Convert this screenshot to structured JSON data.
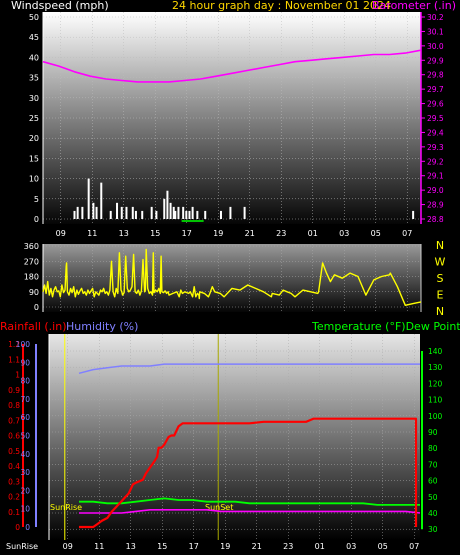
{
  "header": {
    "windspeed": "Windspeed (mph)",
    "day": "24 hour graph day : November 01 2024",
    "barometer": "Barometer (.in)"
  },
  "colors": {
    "windspeed": "#ffffff",
    "barometer": "#ff00ff",
    "day": "#ffd700",
    "wind_dir": "#ffff00",
    "rainfall": "#ff0000",
    "humidity": "#8080ff",
    "temperature": "#00ff00",
    "dew_point": "#ff00ff",
    "sun": "#ffff00"
  },
  "chart_data": [
    {
      "type": "line",
      "title": "24 hour graph day : November 01 2024",
      "x_tick_labels": [
        "09",
        "11",
        "13",
        "15",
        "17",
        "19",
        "21",
        "23",
        "01",
        "03",
        "05",
        "07"
      ],
      "y_left": {
        "label": "Windspeed (mph)",
        "ticks": [
          0,
          5,
          10,
          15,
          20,
          25,
          30,
          35,
          40,
          45,
          50
        ],
        "ylim": [
          0,
          50
        ]
      },
      "y_right": {
        "label": "Barometer (.in)",
        "ticks": [
          28.8,
          28.9,
          29.0,
          29.1,
          29.2,
          29.3,
          29.4,
          29.5,
          29.6,
          29.7,
          29.8,
          29.9,
          30.0,
          30.1,
          30.2
        ],
        "ylim": [
          28.8,
          30.2
        ]
      },
      "series": [
        {
          "name": "Barometer (.in)",
          "axis": "right",
          "kind": "line",
          "x": [
            0,
            1,
            2,
            3,
            4,
            5,
            6,
            7,
            8,
            9,
            10,
            11,
            12,
            13,
            14,
            15,
            16,
            17,
            18,
            19,
            20,
            21,
            22,
            23,
            24
          ],
          "values": [
            29.89,
            29.86,
            29.82,
            29.79,
            29.77,
            29.76,
            29.75,
            29.75,
            29.75,
            29.76,
            29.77,
            29.79,
            29.81,
            29.83,
            29.85,
            29.87,
            29.89,
            29.9,
            29.91,
            29.92,
            29.93,
            29.94,
            29.94,
            29.95,
            29.97
          ]
        },
        {
          "name": "Windspeed (mph)",
          "axis": "left",
          "kind": "bar",
          "x": [
            2.0,
            2.2,
            2.5,
            2.9,
            3.2,
            3.4,
            3.7,
            4.3,
            4.7,
            5.0,
            5.3,
            5.7,
            5.9,
            6.3,
            6.9,
            7.2,
            7.7,
            7.9,
            8.1,
            8.3,
            8.4,
            8.6,
            8.9,
            9.1,
            9.3,
            9.5,
            9.8,
            10.3,
            11.3,
            11.9,
            12.8,
            23.5
          ],
          "values": [
            2,
            3,
            3,
            10,
            4,
            3,
            9,
            2,
            4,
            3,
            3,
            3,
            2,
            2,
            3,
            2,
            5,
            7,
            4,
            3,
            2,
            3,
            3,
            2,
            2,
            3,
            2,
            2,
            2,
            3,
            3,
            2
          ]
        }
      ]
    },
    {
      "type": "line",
      "x_tick_labels": [
        "09",
        "11",
        "13",
        "15",
        "17",
        "19",
        "21",
        "23",
        "01",
        "03",
        "05",
        "07"
      ],
      "y_left": {
        "ticks": [
          0,
          90,
          180,
          270,
          360
        ],
        "ylim": [
          0,
          360
        ]
      },
      "y_right_labels": [
        "N",
        "W",
        "S",
        "E",
        "N"
      ],
      "series": [
        {
          "name": "Wind Direction",
          "kind": "line",
          "x": [
            0.0,
            0.2,
            0.4,
            0.6,
            0.8,
            1.0,
            1.2,
            1.4,
            1.6,
            1.8,
            2.0,
            2.2,
            2.4,
            2.6,
            2.8,
            2.95,
            3.0,
            3.1,
            3.3,
            3.5,
            3.7,
            3.9,
            4.1,
            4.3,
            4.5,
            4.7,
            4.9,
            5.1,
            5.3,
            5.5,
            5.7,
            5.9,
            6.1,
            6.3,
            6.5,
            6.7,
            6.9,
            7.1,
            7.3,
            7.5,
            7.7,
            7.9,
            8.1,
            8.3,
            8.5,
            8.7,
            8.9,
            9.1,
            9.3,
            9.5,
            9.7,
            9.9,
            10.0,
            10.1,
            10.3,
            10.5,
            10.7,
            10.9,
            11.1,
            11.3,
            11.5,
            11.7,
            11.9,
            12.1,
            12.3,
            12.5,
            12.7,
            12.9,
            13.0,
            13.1,
            13.3,
            13.5,
            13.7,
            13.9,
            14.0,
            14.1,
            14.3,
            14.5,
            14.7,
            14.9,
            15.0,
            15.1,
            15.3,
            15.5,
            15.7,
            15.9,
            16.0,
            16.5,
            17.0,
            17.3,
            17.5,
            17.7,
            18.0,
            18.5,
            18.7,
            19.0,
            19.2,
            19.4,
            19.6,
            19.8,
            19.85,
            19.9,
            20.5,
            21.0,
            21.2,
            21.5,
            21.8,
            22.5,
            23.0,
            24.0,
            25.0,
            26.0,
            27.0,
            28.0,
            29.0,
            29.1,
            30.0,
            30.5,
            31.0,
            31.5,
            32.0,
            33.0,
            34.0,
            34.9,
            35.0,
            35.5,
            36.0,
            36.5,
            37.0,
            38.0,
            39.0,
            40.0,
            41.0,
            42.0,
            43.0,
            44.0,
            44.1,
            45.0,
            46.0,
            47.0,
            48.0
          ],
          "values": [
            90,
            130,
            80,
            150,
            70,
            110,
            60,
            100,
            120,
            90,
            95,
            60,
            130,
            85,
            100,
            240,
            260,
            90,
            70,
            110,
            85,
            120,
            60,
            100,
            75,
            95,
            110,
            80,
            90,
            70,
            100,
            80,
            95,
            110,
            60,
            90,
            80,
            70,
            100,
            90,
            110,
            80,
            90,
            70,
            100,
            270,
            90,
            60,
            110,
            80,
            320,
            100,
            90,
            70,
            85,
            300,
            110,
            90,
            100,
            120,
            310,
            90,
            80,
            100,
            70,
            95,
            280,
            90,
            100,
            340,
            110,
            80,
            90,
            70,
            320,
            85,
            100,
            90,
            110,
            80,
            300,
            90,
            85,
            95,
            80,
            90,
            70,
            80,
            90,
            60,
            100,
            80,
            90,
            80,
            90,
            60,
            120,
            60,
            80,
            70,
            50,
            90,
            80,
            60,
            80,
            120,
            90,
            80,
            60,
            110,
            100,
            130,
            110,
            90,
            60,
            80,
            70,
            100,
            90,
            80,
            60,
            100,
            90,
            80,
            90,
            260,
            200,
            150,
            190,
            170,
            200,
            180,
            70,
            160,
            180,
            190,
            200,
            120,
            10,
            20,
            30
          ],
          "note_x_scale": "half-hours"
        }
      ]
    },
    {
      "type": "line",
      "x_tick_labels": [
        "SunRise",
        "09",
        "11",
        "13",
        "15",
        "17",
        "19",
        "21",
        "23",
        "01",
        "03",
        "05",
        "07"
      ],
      "y_left_outer": {
        "label": "Rainfall (.in)",
        "ticks": [
          0,
          0.1,
          0.2,
          0.3,
          0.4,
          0.5,
          0.6,
          0.7,
          0.8,
          0.9,
          1,
          1.1,
          1.2
        ],
        "ylim": [
          0,
          1.2
        ]
      },
      "y_left_inner": {
        "label": "Humidity (%)",
        "ticks": [
          0,
          10,
          20,
          30,
          40,
          50,
          60,
          70,
          80,
          90,
          100
        ],
        "ylim": [
          0,
          100
        ]
      },
      "y_right": {
        "label": "Temperature (°F)Dew Point (°F)",
        "ticks": [
          30,
          40,
          50,
          60,
          70,
          80,
          90,
          100,
          110,
          120,
          130,
          140
        ],
        "ylim": [
          30,
          140
        ]
      },
      "annotations": [
        "SunRise",
        "SunSet"
      ],
      "series": [
        {
          "name": "Rainfall (.in)",
          "axis": "left_outer",
          "x": [
            0,
            0.3,
            1,
            1.3,
            1.6,
            2,
            2.3,
            2.6,
            3,
            3.5,
            3.8,
            4,
            4.5,
            4.7,
            5,
            5.3,
            5.5,
            5.6,
            5.8,
            6,
            6.3,
            6.5,
            6.7,
            7,
            7.3,
            8,
            9,
            10,
            11,
            12,
            13,
            14,
            15,
            16,
            16.5,
            17,
            18,
            19,
            20,
            21,
            22,
            23,
            24,
            24.01
          ],
          "values": [
            0,
            0,
            0,
            0.02,
            0.04,
            0.06,
            0.1,
            0.13,
            0.17,
            0.22,
            0.28,
            0.29,
            0.31,
            0.35,
            0.39,
            0.43,
            0.46,
            0.52,
            0.52,
            0.54,
            0.59,
            0.6,
            0.6,
            0.66,
            0.68,
            0.68,
            0.68,
            0.68,
            0.68,
            0.68,
            0.69,
            0.69,
            0.69,
            0.69,
            0.71,
            0.71,
            0.71,
            0.71,
            0.71,
            0.71,
            0.71,
            0.71,
            0.71,
            0
          ]
        },
        {
          "name": "Humidity (%)",
          "axis": "left_inner",
          "x": [
            0,
            1,
            2,
            3,
            4,
            5,
            6,
            7,
            8,
            9,
            10,
            11,
            12,
            13,
            14,
            15,
            16,
            17,
            18,
            19,
            20,
            21,
            22,
            23,
            24
          ],
          "values": [
            84,
            86,
            87,
            88,
            88,
            88,
            89,
            89,
            89,
            89,
            89,
            89,
            89,
            89,
            89,
            89,
            89,
            89,
            89,
            89,
            89,
            89,
            89,
            89,
            89
          ]
        },
        {
          "name": "Temperature (°F)",
          "axis": "right",
          "x": [
            0,
            1,
            2,
            3,
            4,
            5,
            6,
            7,
            8,
            9,
            10,
            11,
            12,
            13,
            14,
            15,
            16,
            17,
            18,
            19,
            20,
            21,
            22,
            23,
            24
          ],
          "values": [
            47,
            47,
            46,
            46,
            47,
            48,
            49,
            48,
            48,
            47,
            47,
            47,
            46,
            46,
            46,
            46,
            46,
            46,
            46,
            46,
            46,
            45,
            45,
            45,
            45
          ]
        },
        {
          "name": "Dew Point (°F)",
          "axis": "right",
          "x": [
            0,
            1,
            2,
            3,
            4,
            5,
            6,
            7,
            8,
            9,
            10,
            11,
            12,
            13,
            14,
            15,
            16,
            17,
            18,
            19,
            20,
            21,
            22,
            23,
            24
          ],
          "values": [
            40,
            40,
            40,
            40,
            41,
            42,
            42,
            42,
            42,
            42,
            41,
            41,
            41,
            41,
            41,
            41,
            41,
            41,
            41,
            41,
            41,
            41,
            41,
            41,
            40
          ]
        }
      ]
    }
  ]
}
